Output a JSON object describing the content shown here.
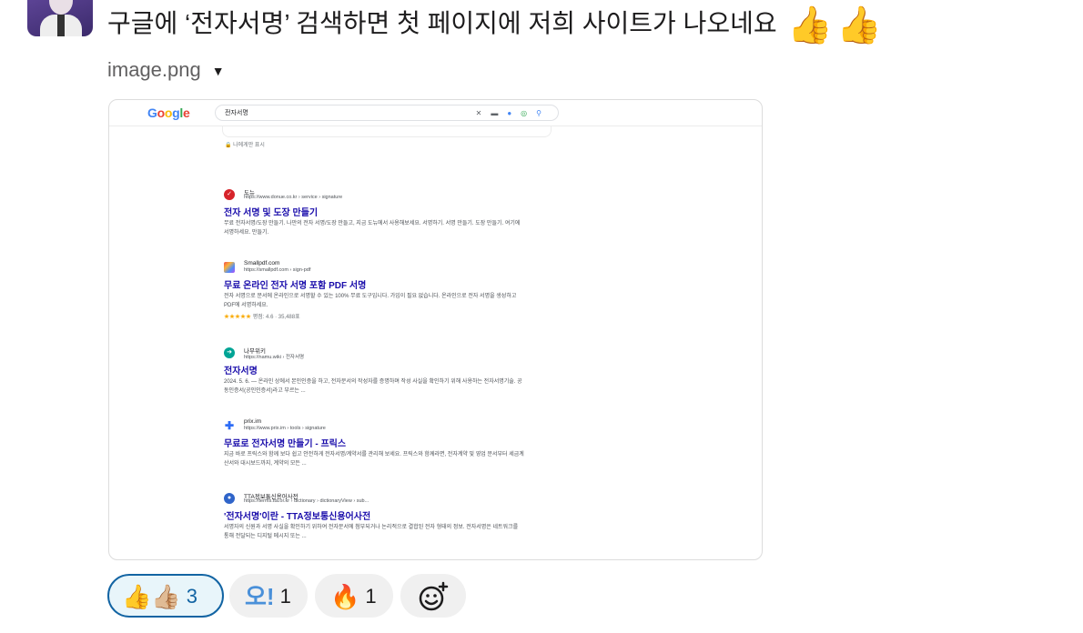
{
  "message": {
    "text": "구글에 ‘전자서명’ 검색하면 첫 페이지에 저희 사이트가 나오네요",
    "emoji": "👍"
  },
  "attachment": {
    "file_name": "image.png"
  },
  "google": {
    "query": "전자서명",
    "personal_note": "나에게만 표시",
    "results": [
      {
        "site": "도뉴",
        "url": "https://www.donue.co.kr › service › signature",
        "title": "전자 서명 및 도장 만들기",
        "snippet": "무료 전자서명/도장 만들기. 나만의 전자 서명/도장 만들고, 지금 도뉴에서 사용해보세요. 서명하기. 서명 만들기. 도장 만들기. 여기에 서명하세요. 만들기."
      },
      {
        "site": "Smallpdf.com",
        "url": "https://smallpdf.com › sign-pdf",
        "title": "무료 온라인 전자 서명 포함 PDF 서명",
        "snippet": "전자 서명으로 문서에 온라인으로 서명할 수 있는 100% 무료 도구입니다. 가입이 필요 없습니다. 온라인으로 전자 서명을 생성하고 PDF에 서명하세요.",
        "rating_stars": "★★★★★",
        "rating": "평점: 4.6 · 35,488표"
      },
      {
        "site": "나무위키",
        "url": "https://namu.wiki › 전자서명",
        "title": "전자서명",
        "snippet": "2024. 5. 6. — 온라인 상에서 본인인증을 하고, 전자문서의 작성자를 증명하며 작성 사실을 확인하기 위해 사용하는 전자서명기술. 공동인증서(공인인증서)라고 부르는 ..."
      },
      {
        "site": "prix.im",
        "url": "https://www.prix.im › tools › signature",
        "title": "무료로 전자서명 만들기 - 프릭스",
        "snippet": "지금 바로 프릭스와 함께 보다 쉽고 안전하게 전자서명/계약서를 관리해 보세요. 프릭스와 함께라면, 전자계약 및 영업 문서부터 세금계산서와 대시보드까지, 계약의 모든 ..."
      },
      {
        "site": "TTA정보통신용어사전",
        "url": "https://terms.tta.or.kr › dictionary › dictionaryView › sub...",
        "title": "'전자서명'이란 - TTA정보통신용어사전",
        "snippet": "서명자의 신원과 서명 사실을 확인하기 위하여 전자문서에 첨부되거나 논리적으로 결합된 전자 형태의 정보. 전자서명은 네트워크를 통해 전달되는 디지털 메시지 또는 ..."
      }
    ]
  },
  "reactions": [
    {
      "emoji": "👍",
      "emoji2": "👍🏼",
      "count": "3",
      "active": true
    },
    {
      "emoji": "오!",
      "count": "1",
      "active": false
    },
    {
      "emoji": "🔥",
      "count": "1",
      "active": false
    }
  ],
  "add_reaction_icon": "add-emoji-icon"
}
